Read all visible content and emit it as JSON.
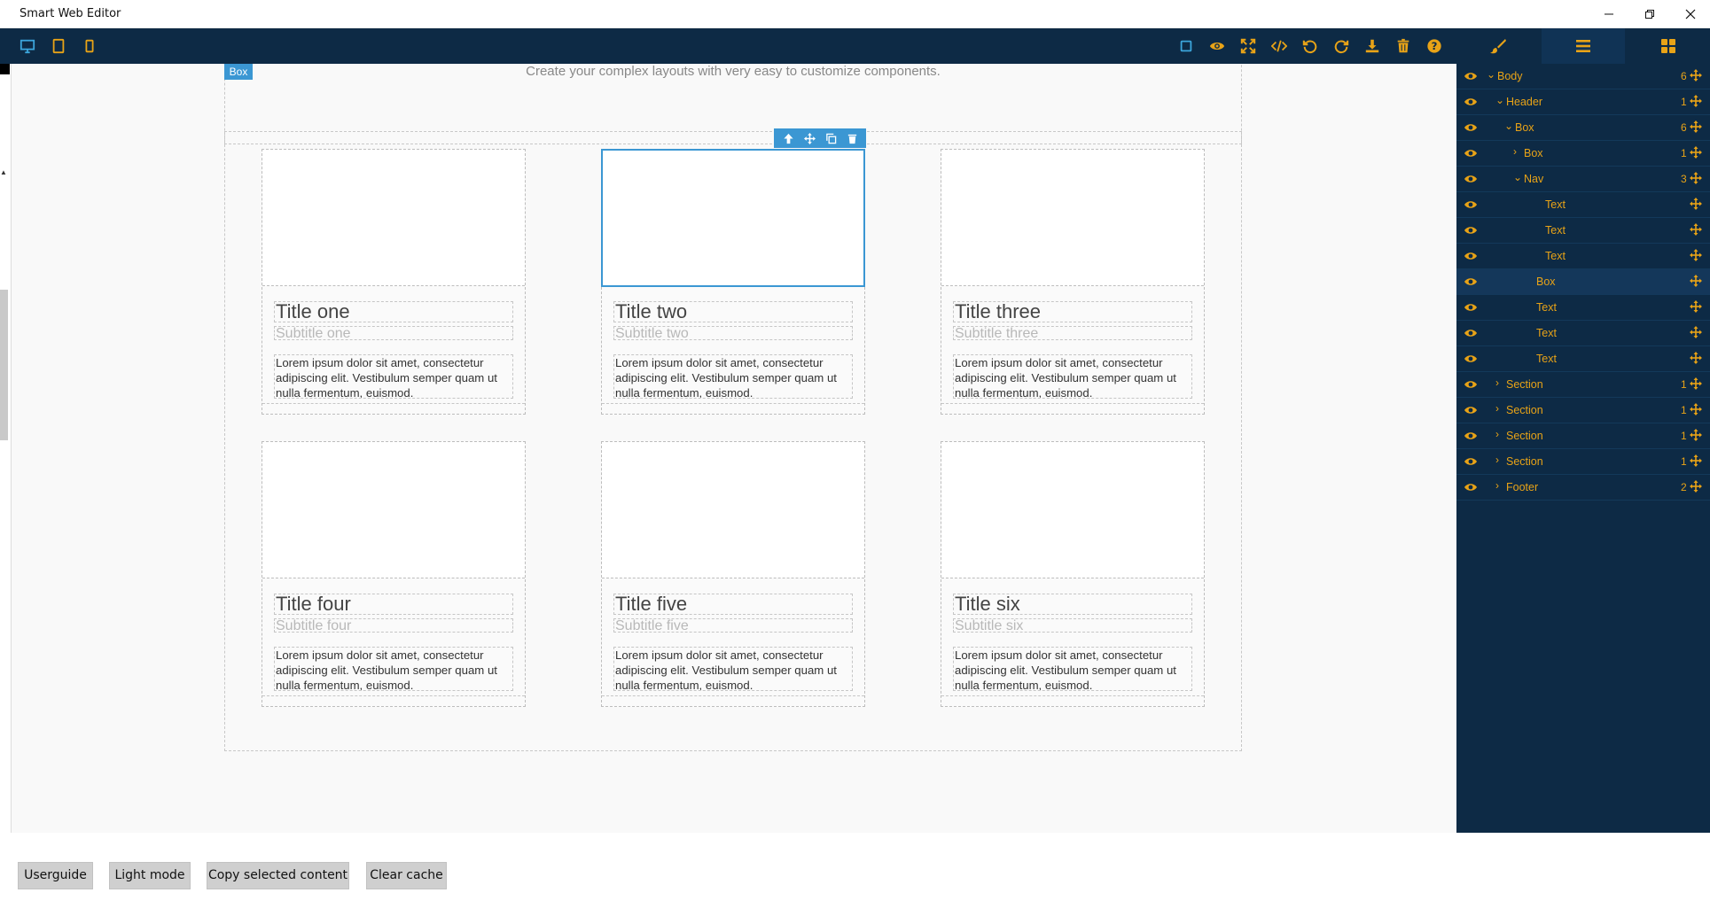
{
  "window": {
    "title": "Smart Web Editor"
  },
  "colors": {
    "accent": "#e8a317",
    "panel": "#0d2a45",
    "selection": "#3b97d3"
  },
  "toolbar": {
    "devices": [
      "desktop-icon",
      "tablet-icon",
      "mobile-icon"
    ],
    "actions": [
      "square-icon",
      "eye-icon",
      "fullscreen-icon",
      "code-icon",
      "undo-icon",
      "redo-icon",
      "download-icon",
      "trash-icon",
      "help-icon"
    ],
    "panels": [
      "brush-icon",
      "layers-icon",
      "blocks-icon"
    ]
  },
  "canvas": {
    "badge": "Box",
    "subtitle": "Create your complex layouts with very easy to customize components.",
    "cards": [
      {
        "title": "Title one",
        "subtitle": "Subtitle one",
        "text": "Lorem ipsum dolor sit amet, consectetur adipiscing elit. Vestibulum semper quam ut nulla fermentum, euismod."
      },
      {
        "title": "Title two",
        "subtitle": "Subtitle two",
        "text": "Lorem ipsum dolor sit amet, consectetur adipiscing elit. Vestibulum semper quam ut nulla fermentum, euismod."
      },
      {
        "title": "Title three",
        "subtitle": "Subtitle three",
        "text": "Lorem ipsum dolor sit amet, consectetur adipiscing elit. Vestibulum semper quam ut nulla fermentum, euismod."
      },
      {
        "title": "Title four",
        "subtitle": "Subtitle four",
        "text": "Lorem ipsum dolor sit amet, consectetur adipiscing elit. Vestibulum semper quam ut nulla fermentum, euismod."
      },
      {
        "title": "Title five",
        "subtitle": "Subtitle five",
        "text": "Lorem ipsum dolor sit amet, consectetur adipiscing elit. Vestibulum semper quam ut nulla fermentum, euismod."
      },
      {
        "title": "Title six",
        "subtitle": "Subtitle six",
        "text": "Lorem ipsum dolor sit amet, consectetur adipiscing elit. Vestibulum semper quam ut nulla fermentum, euismod."
      }
    ]
  },
  "layers": [
    {
      "name": "Body",
      "count": "6",
      "chevron": "⌄"
    },
    {
      "name": "Header",
      "count": "1",
      "chevron": "⌄"
    },
    {
      "name": "Box",
      "count": "6",
      "chevron": "⌄"
    },
    {
      "name": "Box",
      "count": "1",
      "chevron": "›"
    },
    {
      "name": "Nav",
      "count": "3",
      "chevron": "⌄"
    },
    {
      "name": "Text",
      "count": "",
      "chevron": ""
    },
    {
      "name": "Text",
      "count": "",
      "chevron": ""
    },
    {
      "name": "Text",
      "count": "",
      "chevron": ""
    },
    {
      "name": "Box",
      "count": "",
      "chevron": ""
    },
    {
      "name": "Text",
      "count": "",
      "chevron": ""
    },
    {
      "name": "Text",
      "count": "",
      "chevron": ""
    },
    {
      "name": "Text",
      "count": "",
      "chevron": ""
    },
    {
      "name": "Section",
      "count": "1",
      "chevron": "›"
    },
    {
      "name": "Section",
      "count": "1",
      "chevron": "›"
    },
    {
      "name": "Section",
      "count": "1",
      "chevron": "›"
    },
    {
      "name": "Section",
      "count": "1",
      "chevron": "›"
    },
    {
      "name": "Footer",
      "count": "2",
      "chevron": "›"
    }
  ],
  "bottom_buttons": [
    "Userguide",
    "Light mode",
    "Copy selected content",
    "Clear cache"
  ]
}
